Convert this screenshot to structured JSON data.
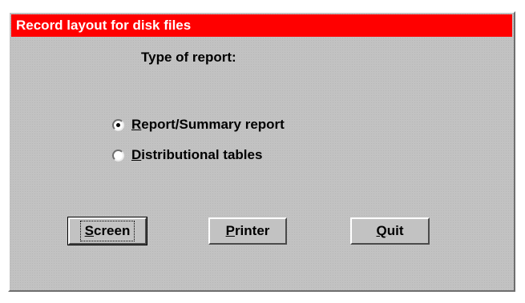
{
  "window": {
    "title": "Record layout for disk files",
    "title_bar_color": "#ff0000"
  },
  "prompt": "Type of report:",
  "report_types": [
    {
      "key": "R",
      "rest": "eport/Summary report",
      "selected": true
    },
    {
      "key": "D",
      "rest": "istributional tables",
      "selected": false
    }
  ],
  "buttons": {
    "screen": {
      "key": "S",
      "rest": "creen"
    },
    "printer": {
      "key": "P",
      "rest": "rinter"
    },
    "quit": {
      "key": "Q",
      "rest": "uit"
    }
  }
}
